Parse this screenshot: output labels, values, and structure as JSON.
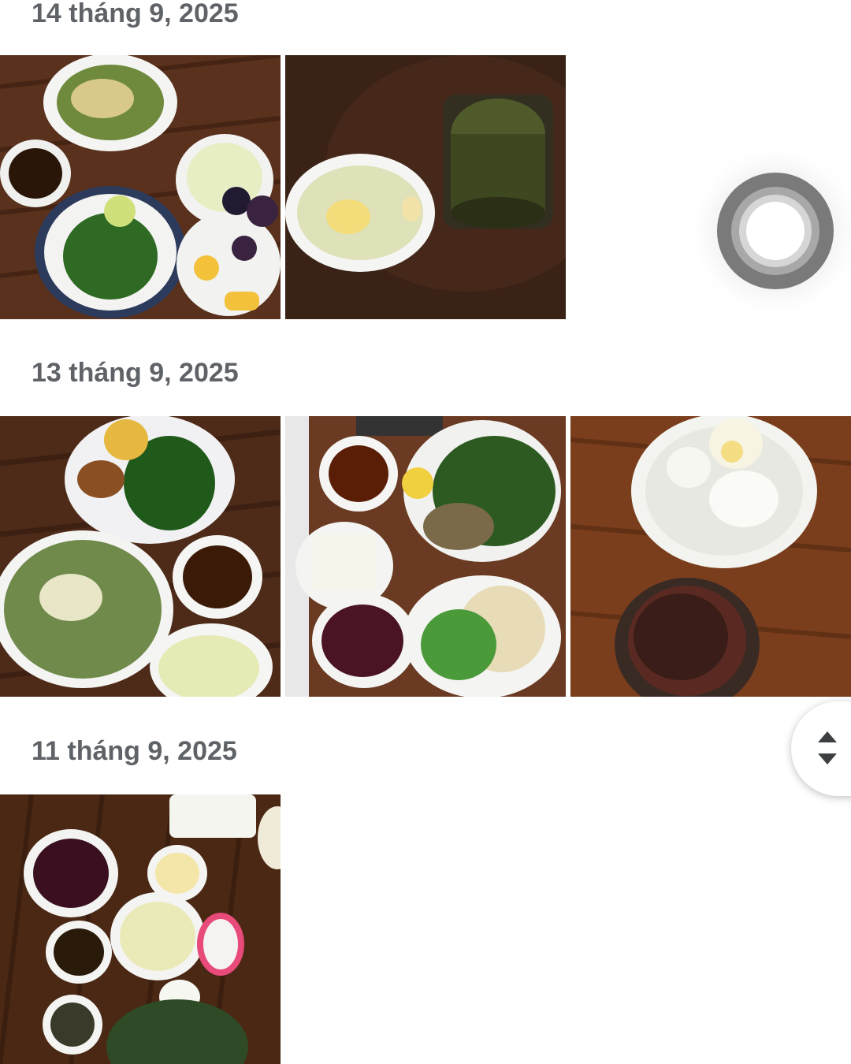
{
  "sections": [
    {
      "date": "14 tháng 9, 2025",
      "photos": [
        {
          "description": "food-photo-vegetables-corn-noodles"
        },
        {
          "description": "food-photo-dessert-bowl-green-drink"
        }
      ]
    },
    {
      "date": "13 tháng 9, 2025",
      "photos": [
        {
          "description": "food-photo-salad-sweet-potato-greens"
        },
        {
          "description": "food-photo-tofu-rice-noodles-greens"
        },
        {
          "description": "food-photo-boiled-eggs-dark-drink"
        }
      ]
    },
    {
      "date": "11 tháng 9, 2025",
      "photos": [
        {
          "description": "food-photo-rice-soup-egg-dragonfruit"
        }
      ]
    }
  ],
  "assistive_touch": {
    "icon": "assistive-touch-icon"
  },
  "scroll_handle": {
    "icon": "scroll-handle-icon"
  },
  "colors": {
    "date_text": "#5f6368",
    "wood_dark": "#4a2a18",
    "wood_light": "#7a4526"
  }
}
